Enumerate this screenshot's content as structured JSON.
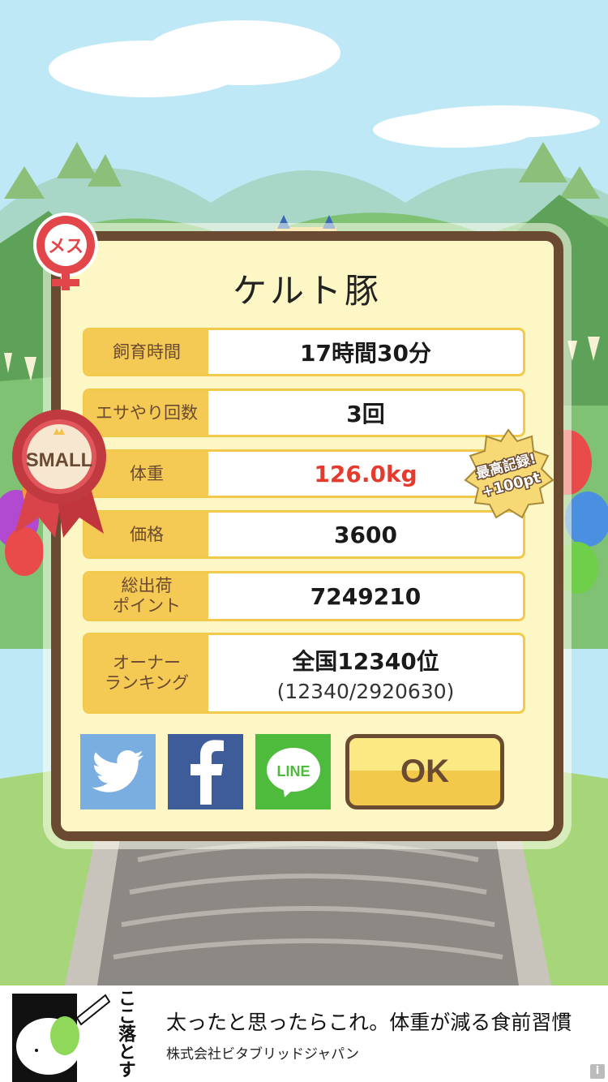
{
  "dialog": {
    "title": "ケルト豚",
    "rows": [
      {
        "label": "飼育時間",
        "value": "17時間30分"
      },
      {
        "label": "エサやり回数",
        "value": "3回"
      },
      {
        "label": "体重",
        "value": "126.0kg",
        "highlight": "#e53b2f"
      },
      {
        "label": "価格",
        "value": "3600"
      },
      {
        "label": "総出荷\nポイント",
        "value": "7249210"
      },
      {
        "label": "オーナー\nランキング",
        "value": "全国12340位",
        "sub": "(12340/2920630)"
      }
    ],
    "share_buttons": [
      {
        "name": "twitter",
        "icon": "twitter-bird-icon"
      },
      {
        "name": "facebook",
        "icon": "facebook-f-icon"
      },
      {
        "name": "line",
        "icon": "line-bubble-icon",
        "label": "LINE"
      }
    ],
    "ok_label": "OK"
  },
  "badges": {
    "gender": "メス",
    "size": "SMALL",
    "record_line1": "最高記録!",
    "record_line2": "+100pt"
  },
  "ad": {
    "side_text": "ここ落とす",
    "title": "太ったと思ったらこれ。体重が減る食前習慣",
    "advertiser": "株式会社ビタブリッドジャパン",
    "info_icon": "i"
  },
  "colors": {
    "frame": "#6b4a32",
    "panel": "#fdf6c5",
    "label_bg": "#f5ca54",
    "accent_red": "#e53b2f",
    "twitter": "#7aaee0",
    "facebook": "#3f5c9a",
    "line": "#4fbb3c"
  }
}
